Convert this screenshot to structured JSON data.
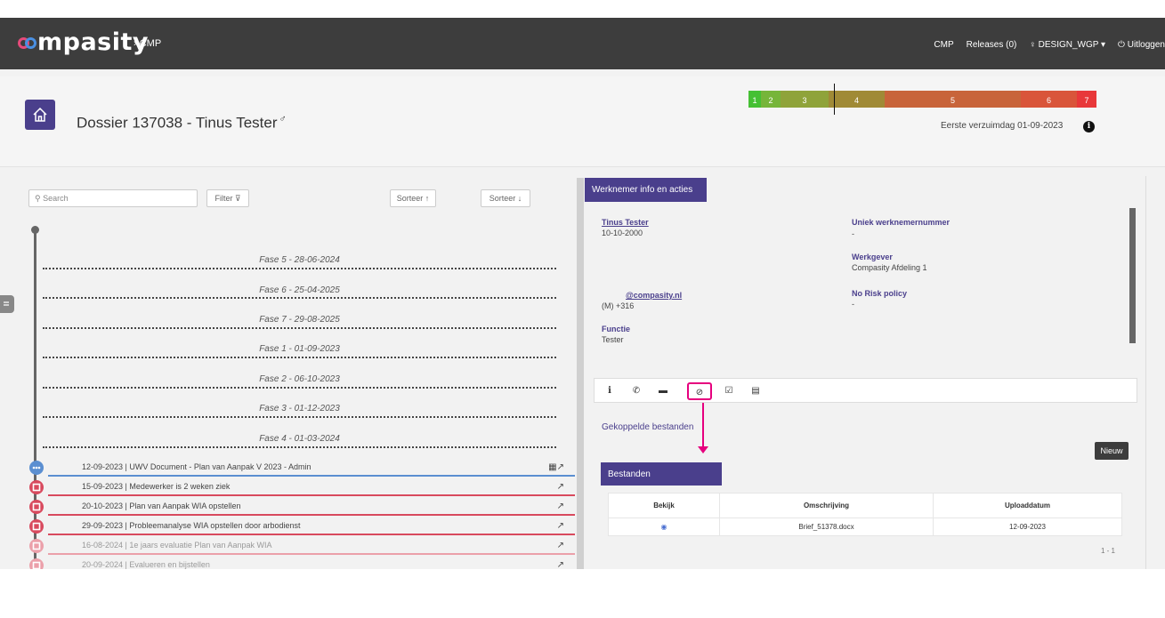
{
  "brand": {
    "logo_text": "mpasity",
    "crumb": "› CMP"
  },
  "nav": {
    "cmp": "CMP",
    "releases": "Releases (0)",
    "user": "♀ DESIGN_WGP ▾",
    "logout": "⏻ Uitloggen"
  },
  "header": {
    "title": "Dossier 137038 - Tinus Tester",
    "gender_symbol": "♂",
    "verzuim": "Eerste verzuimdag 01-09-2023",
    "info": "i",
    "phases": [
      {
        "label": "1",
        "color": "#45c034"
      },
      {
        "label": "2",
        "color": "#76b53a"
      },
      {
        "label": "3",
        "color": "#8fa33a"
      },
      {
        "label": "4",
        "color": "#a08a36"
      },
      {
        "label": "5",
        "color": "#c8643a"
      },
      {
        "label": "6",
        "color": "#d9553a"
      },
      {
        "label": "7",
        "color": "#e8383a"
      }
    ]
  },
  "timeline": {
    "search_placeholder": "Search",
    "filter": "Filter ⊽",
    "sort_up": "Sorteer ↑",
    "sort_down": "Sorteer ↓",
    "fases": [
      "Fase 5 - 28-06-2024",
      "Fase 6 - 25-04-2025",
      "Fase 7 - 29-08-2025",
      "Fase 1 - 01-09-2023",
      "Fase 2 - 06-10-2023",
      "Fase 3 - 01-12-2023",
      "Fase 4 - 01-03-2024"
    ],
    "events": [
      {
        "text": "12-09-2023 | UWV Document - Plan van Aanpak V 2023 - Admin",
        "icon": "▦↗",
        "dot_color": "#5b8fd1",
        "line_color": "#5b8fd1",
        "faded": false
      },
      {
        "text": "15-09-2023 | Medewerker is 2 weken ziek",
        "icon": "↗",
        "dot_color": "#d84a5e",
        "line_color": "#d84a5e",
        "faded": false
      },
      {
        "text": "20-10-2023 | Plan van Aanpak WIA opstellen",
        "icon": "↗",
        "dot_color": "#d84a5e",
        "line_color": "#d84a5e",
        "faded": false
      },
      {
        "text": "29-09-2023 | Probleemanalyse WIA opstellen door arbodienst",
        "icon": "↗",
        "dot_color": "#d84a5e",
        "line_color": "#d84a5e",
        "faded": false
      },
      {
        "text": "16-08-2024 | 1e jaars evaluatie Plan van Aanpak WIA",
        "icon": "↗",
        "dot_color": "#eba0aa",
        "line_color": "#eba0aa",
        "faded": true
      },
      {
        "text": "20-09-2024 | Evalueren en bijstellen",
        "icon": "↗",
        "dot_color": "#eba0aa",
        "line_color": "#eba0aa",
        "faded": true
      }
    ]
  },
  "werknemer": {
    "tab": "Werknemer info en acties",
    "name": "Tinus Tester",
    "dob": "10-10-2000",
    "email": "@compasity.nl",
    "phone": "(M) +316",
    "functie_label": "Functie",
    "functie": "Tester",
    "uniek_label": "Uniek werknemernummer",
    "uniek": "-",
    "werkgever_label": "Werkgever",
    "werkgever": "Compasity Afdeling 1",
    "norisk_label": "No Risk policy",
    "norisk": "-"
  },
  "actions": {
    "info": "i",
    "phone": "✆",
    "chat": "▬",
    "attach": "⊘",
    "check": "☑",
    "archive": "▤"
  },
  "files": {
    "section_title": "Gekoppelde bestanden",
    "new_button": "Nieuw",
    "tab": "Bestanden",
    "columns": [
      "Bekijk",
      "Omschrijving",
      "Uploaddatum"
    ],
    "rows": [
      {
        "view": "◉",
        "description": "Brief_51378.docx",
        "date": "12-09-2023"
      }
    ],
    "pager": "1 - 1"
  }
}
